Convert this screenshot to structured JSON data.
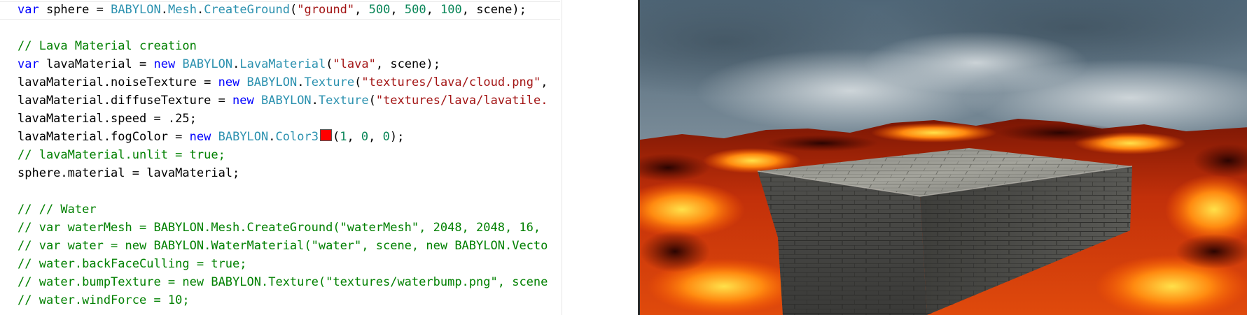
{
  "editor": {
    "lines": [
      {
        "tokens": [
          {
            "c": "kw",
            "t": "var"
          },
          {
            "c": "pl",
            "t": " sphere = "
          },
          {
            "c": "ty",
            "t": "BABYLON"
          },
          {
            "c": "pl",
            "t": "."
          },
          {
            "c": "ty",
            "t": "Mesh"
          },
          {
            "c": "pl",
            "t": "."
          },
          {
            "c": "ty",
            "t": "CreateGround"
          },
          {
            "c": "pl",
            "t": "("
          },
          {
            "c": "st",
            "t": "\"ground\""
          },
          {
            "c": "pl",
            "t": ", "
          },
          {
            "c": "nu",
            "t": "500"
          },
          {
            "c": "pl",
            "t": ", "
          },
          {
            "c": "nu",
            "t": "500"
          },
          {
            "c": "pl",
            "t": ", "
          },
          {
            "c": "nu",
            "t": "100"
          },
          {
            "c": "pl",
            "t": ", scene);"
          }
        ]
      },
      {
        "tokens": []
      },
      {
        "tokens": [
          {
            "c": "cm",
            "t": "// Lava Material creation"
          }
        ]
      },
      {
        "tokens": [
          {
            "c": "kw",
            "t": "var"
          },
          {
            "c": "pl",
            "t": " lavaMaterial = "
          },
          {
            "c": "kw",
            "t": "new"
          },
          {
            "c": "pl",
            "t": " "
          },
          {
            "c": "ty",
            "t": "BABYLON"
          },
          {
            "c": "pl",
            "t": "."
          },
          {
            "c": "ty",
            "t": "LavaMaterial"
          },
          {
            "c": "pl",
            "t": "("
          },
          {
            "c": "st",
            "t": "\"lava\""
          },
          {
            "c": "pl",
            "t": ", scene);"
          }
        ]
      },
      {
        "tokens": [
          {
            "c": "pl",
            "t": "lavaMaterial.noiseTexture = "
          },
          {
            "c": "kw",
            "t": "new"
          },
          {
            "c": "pl",
            "t": " "
          },
          {
            "c": "ty",
            "t": "BABYLON"
          },
          {
            "c": "pl",
            "t": "."
          },
          {
            "c": "ty",
            "t": "Texture"
          },
          {
            "c": "pl",
            "t": "("
          },
          {
            "c": "st",
            "t": "\"textures/lava/cloud.png\""
          },
          {
            "c": "pl",
            "t": ","
          }
        ]
      },
      {
        "tokens": [
          {
            "c": "pl",
            "t": "lavaMaterial.diffuseTexture = "
          },
          {
            "c": "kw",
            "t": "new"
          },
          {
            "c": "pl",
            "t": " "
          },
          {
            "c": "ty",
            "t": "BABYLON"
          },
          {
            "c": "pl",
            "t": "."
          },
          {
            "c": "ty",
            "t": "Texture"
          },
          {
            "c": "pl",
            "t": "("
          },
          {
            "c": "st",
            "t": "\"textures/lava/lavatile."
          }
        ]
      },
      {
        "tokens": [
          {
            "c": "pl",
            "t": "lavaMaterial.speed = .25;"
          }
        ]
      },
      {
        "tokens": [
          {
            "c": "pl",
            "t": "lavaMaterial.fogColor = "
          },
          {
            "c": "kw",
            "t": "new"
          },
          {
            "c": "pl",
            "t": " "
          },
          {
            "c": "ty",
            "t": "BABYLON"
          },
          {
            "c": "pl",
            "t": "."
          },
          {
            "c": "ty",
            "t": "Color3"
          },
          {
            "c": "swatch",
            "t": ""
          },
          {
            "c": "pl",
            "t": "("
          },
          {
            "c": "nu",
            "t": "1"
          },
          {
            "c": "pl",
            "t": ", "
          },
          {
            "c": "nu",
            "t": "0"
          },
          {
            "c": "pl",
            "t": ", "
          },
          {
            "c": "nu",
            "t": "0"
          },
          {
            "c": "pl",
            "t": ");"
          }
        ]
      },
      {
        "tokens": [
          {
            "c": "cm",
            "t": "// lavaMaterial.unlit = true;"
          }
        ]
      },
      {
        "tokens": [
          {
            "c": "pl",
            "t": "sphere.material = lavaMaterial;"
          }
        ]
      },
      {
        "tokens": []
      },
      {
        "tokens": [
          {
            "c": "cm",
            "t": "// // Water"
          }
        ]
      },
      {
        "tokens": [
          {
            "c": "cm",
            "t": "// var waterMesh = BABYLON.Mesh.CreateGround(\"waterMesh\", 2048, 2048, 16,"
          }
        ]
      },
      {
        "tokens": [
          {
            "c": "cm",
            "t": "// var water = new BABYLON.WaterMaterial(\"water\", scene, new BABYLON.Vecto"
          }
        ]
      },
      {
        "tokens": [
          {
            "c": "cm",
            "t": "// water.backFaceCulling = true;"
          }
        ]
      },
      {
        "tokens": [
          {
            "c": "cm",
            "t": "// water.bumpTexture = new BABYLON.Texture(\"textures/waterbump.png\", scene"
          }
        ]
      },
      {
        "tokens": [
          {
            "c": "cm",
            "t": "// water.windForce = 10;"
          }
        ]
      }
    ],
    "fog_color_swatch": "#ff0000"
  },
  "viewport": {
    "description_colors": {
      "sky_top": "#5a7183",
      "sky_bottom": "#9aa8b2",
      "lava_dark": "#5a0a02",
      "lava_hot": "#ffcc00",
      "stone": "#6b6b66"
    }
  }
}
